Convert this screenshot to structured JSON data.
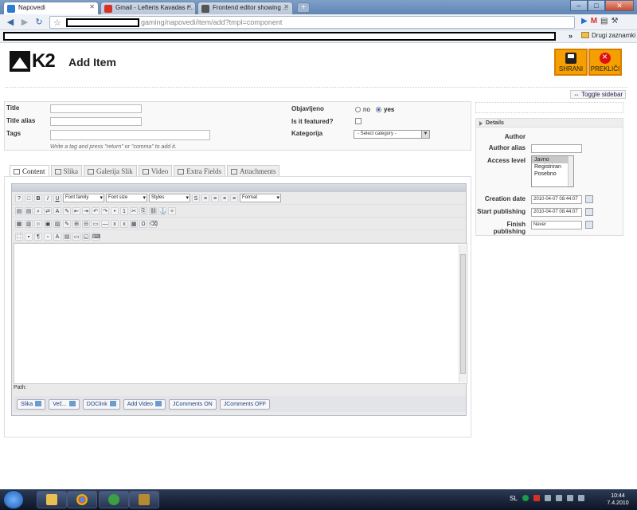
{
  "browser": {
    "tabs": [
      {
        "title": "Napovedi",
        "favicon_color": "#2a7bd4"
      },
      {
        "title": "Gmail - Lefteris Kavadas r...",
        "favicon_color": "#d93025"
      },
      {
        "title": "Frontend editor showing ...",
        "favicon_color": "#555555"
      }
    ],
    "new_tab_label": "+",
    "url_path": "gaming/napovedi/item/add?tmpl=component",
    "bookmarks_overflow": "»",
    "bookmarks_folder": "Drugi zaznamki"
  },
  "header": {
    "logo_text": "K2",
    "title": "Add Item",
    "save_label": "SHRANI",
    "cancel_label": "PREKLIČI",
    "accent_color": "#f5a000"
  },
  "toggle_sidebar": "Toggle sidebar",
  "form": {
    "title_label": "Title",
    "alias_label": "Title alias",
    "tags_label": "Tags",
    "tags_hint": "Write a tag and press \"return\" or \"comma\" to add it.",
    "published_label": "Objavljeno",
    "published_no": "no",
    "published_yes": "yes",
    "featured_label": "Is it featured?",
    "category_label": "Kategorija",
    "category_value": "- Select category -"
  },
  "tabs": [
    {
      "label": "Content"
    },
    {
      "label": "Slika"
    },
    {
      "label": "Galerija Slik"
    },
    {
      "label": "Video"
    },
    {
      "label": "Extra Fields"
    },
    {
      "label": "Attachments"
    }
  ],
  "editor": {
    "font_family": "Font family",
    "font_size": "Font size",
    "styles": "Styles",
    "format": "Format",
    "bold": "B",
    "italic": "I",
    "underline": "U",
    "omega": "Ω",
    "para": "¶",
    "path_label": "Path:",
    "buttons": [
      "Slika",
      "Več...",
      "DOClink",
      "Add Video",
      "JComments ON",
      "JComments OFF"
    ]
  },
  "details": {
    "heading": "Details",
    "author_label": "Author",
    "author_alias_label": "Author alias",
    "access_label": "Access level",
    "access_options": [
      "Javno",
      "Registriran",
      "Posebno"
    ],
    "access_selected": "Javno",
    "creation_label": "Creation date",
    "creation_value": "2010-04-07 08:44:07",
    "start_label": "Start publishing",
    "start_value": "2010-04-07 08:44:07",
    "finish_label": "Finish publishing",
    "finish_value": "Never"
  },
  "taskbar": {
    "lang": "SL",
    "time": "10:44",
    "date": "7.4.2010"
  }
}
